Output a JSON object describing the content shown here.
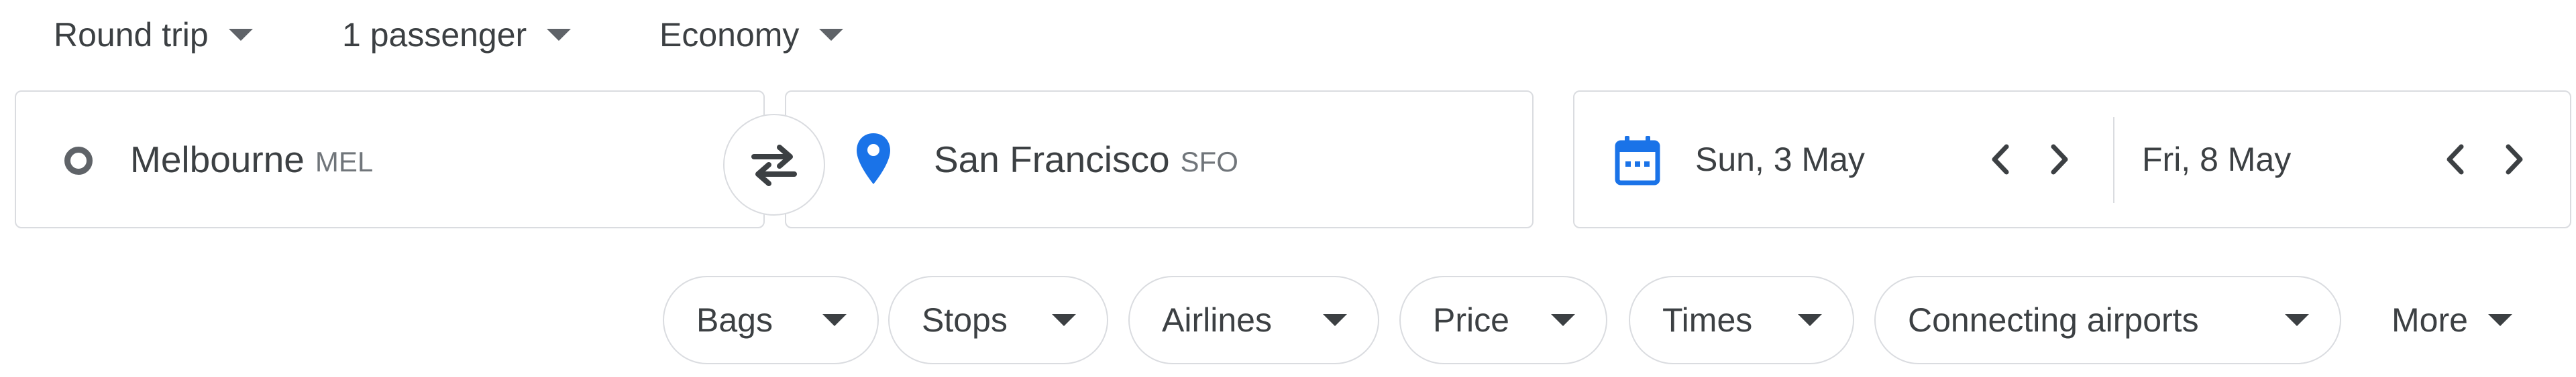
{
  "top_bar": {
    "trip_type": "Round trip",
    "passengers": "1 passenger",
    "cabin_class": "Economy"
  },
  "search": {
    "origin": {
      "city": "Melbourne",
      "code": "MEL"
    },
    "destination": {
      "city": "San Francisco",
      "code": "SFO"
    },
    "departure_date": "Sun, 3 May",
    "return_date": "Fri, 8 May"
  },
  "filters": {
    "chips": [
      "Bags",
      "Stops",
      "Airlines",
      "Price",
      "Times",
      "Connecting airports"
    ],
    "more": "More"
  },
  "icons": {
    "origin": "circle-outline-icon",
    "destination": "location-pin-icon",
    "swap": "swap-arrows-icon",
    "calendar": "calendar-icon",
    "prev": "chevron-left-icon",
    "next": "chevron-right-icon",
    "dropdown": "caret-down-icon"
  },
  "colors": {
    "accent_blue": "#1a73e8",
    "text": "#3c4043",
    "border": "#dadce0",
    "secondary_text": "#70757a"
  }
}
